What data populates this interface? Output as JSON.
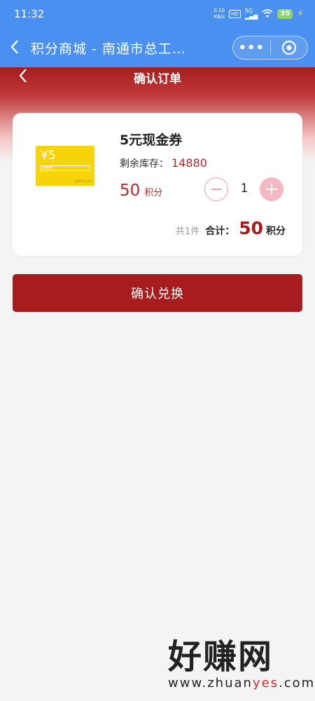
{
  "status_bar": {
    "time": "11:32",
    "net_rate": "0.10",
    "net_unit": "KB/s",
    "hd": "HD",
    "signal": "5G",
    "battery": "35"
  },
  "nav": {
    "back_icon": "chevron-left-icon",
    "title": "积分商城 - 南通市总工…",
    "more_icon": "more-dots-icon",
    "more_text": "•••",
    "home_icon": "target-circle-icon"
  },
  "page": {
    "back_icon": "chevron-left-icon",
    "title": "确认订单"
  },
  "product": {
    "thumb": {
      "yen_text": "¥5",
      "ribbon_text": "现金券",
      "footer_text": "南通市总工会"
    },
    "name": "5元现金券",
    "stock_label": "剩余库存：",
    "stock_value": "14880",
    "price": "50",
    "price_unit": "积分",
    "quantity": "1"
  },
  "summary": {
    "count_text": "共1件",
    "total_label": "合计：",
    "total_value": "50",
    "total_unit": "积分"
  },
  "actions": {
    "confirm_label": "确认兑换"
  },
  "watermark": {
    "brand": "好赚网",
    "url_pre": "www.zhuan",
    "url_accent": "yes",
    "url_post": ".com"
  },
  "colors": {
    "primary_red": "#a71c1c",
    "nav_blue": "#4a90f0",
    "plus_pink": "#f5b8c3"
  }
}
